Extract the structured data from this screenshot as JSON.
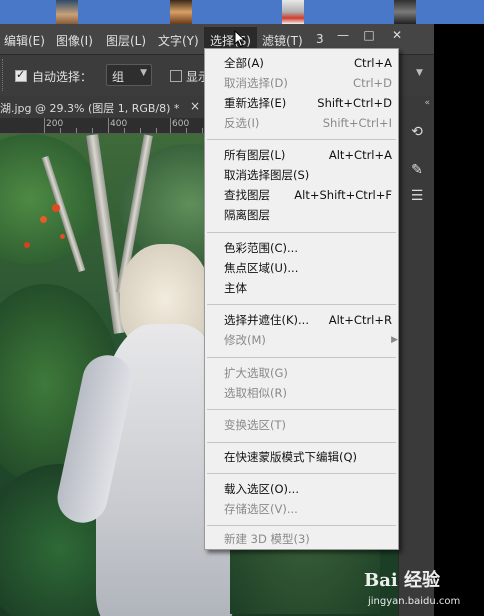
{
  "menubar": {
    "items": [
      "编辑(E)",
      "图像(I)",
      "图层(L)",
      "文字(Y)",
      "选择(S)",
      "滤镜(T)",
      "3"
    ],
    "active_index": 4
  },
  "window_buttons": [
    "—",
    "□",
    "✕"
  ],
  "options_bar": {
    "auto_select_label": "自动选择：",
    "auto_select_checked": true,
    "target_value": "组",
    "show_label": "显示",
    "show_checked": false
  },
  "document": {
    "tab_title": "湖.jpg @ 29.3% (图层 1, RGB/8) *",
    "close_symbol": "×",
    "ruler_labels": [
      "200",
      "400",
      "600"
    ]
  },
  "select_menu": {
    "groups": [
      [
        {
          "label": "全部(A)",
          "shortcut": "Ctrl+A",
          "enabled": true
        },
        {
          "label": "取消选择(D)",
          "shortcut": "Ctrl+D",
          "enabled": false
        },
        {
          "label": "重新选择(E)",
          "shortcut": "Shift+Ctrl+D",
          "enabled": true
        },
        {
          "label": "反选(I)",
          "shortcut": "Shift+Ctrl+I",
          "enabled": false
        }
      ],
      [
        {
          "label": "所有图层(L)",
          "shortcut": "Alt+Ctrl+A",
          "enabled": true
        },
        {
          "label": "取消选择图层(S)",
          "shortcut": "",
          "enabled": true
        },
        {
          "label": "查找图层",
          "shortcut": "Alt+Shift+Ctrl+F",
          "enabled": true
        },
        {
          "label": "隔离图层",
          "shortcut": "",
          "enabled": true
        }
      ],
      [
        {
          "label": "色彩范围(C)...",
          "shortcut": "",
          "enabled": true
        },
        {
          "label": "焦点区域(U)...",
          "shortcut": "",
          "enabled": true
        },
        {
          "label": "主体",
          "shortcut": "",
          "enabled": true
        }
      ],
      [
        {
          "label": "选择并遮住(K)...",
          "shortcut": "Alt+Ctrl+R",
          "enabled": true
        },
        {
          "label": "修改(M)",
          "shortcut": "",
          "enabled": false,
          "submenu": true
        }
      ],
      [
        {
          "label": "扩大选取(G)",
          "shortcut": "",
          "enabled": false
        },
        {
          "label": "选取相似(R)",
          "shortcut": "",
          "enabled": false
        }
      ],
      [
        {
          "label": "变换选区(T)",
          "shortcut": "",
          "enabled": false
        }
      ],
      [
        {
          "label": "在快速蒙版模式下编辑(Q)",
          "shortcut": "",
          "enabled": true
        }
      ],
      [
        {
          "label": "载入选区(O)...",
          "shortcut": "",
          "enabled": true
        },
        {
          "label": "存储选区(V)...",
          "shortcut": "",
          "enabled": false
        }
      ],
      [
        {
          "label": "新建 3D 模型(3)",
          "shortcut": "",
          "enabled": false
        }
      ]
    ]
  },
  "watermark": {
    "logo": "Bai 经验",
    "url": "jingyan.baidu.com"
  },
  "colors": {
    "menubar_bg": "#454545",
    "menu_bg": "#f0f0f0",
    "disabled_text": "#8a8a8a"
  },
  "icons": [
    "cursor-arrow-icon",
    "rotate-view-icon",
    "brush-icon",
    "sliders-icon",
    "collapse-arrows-icon"
  ]
}
